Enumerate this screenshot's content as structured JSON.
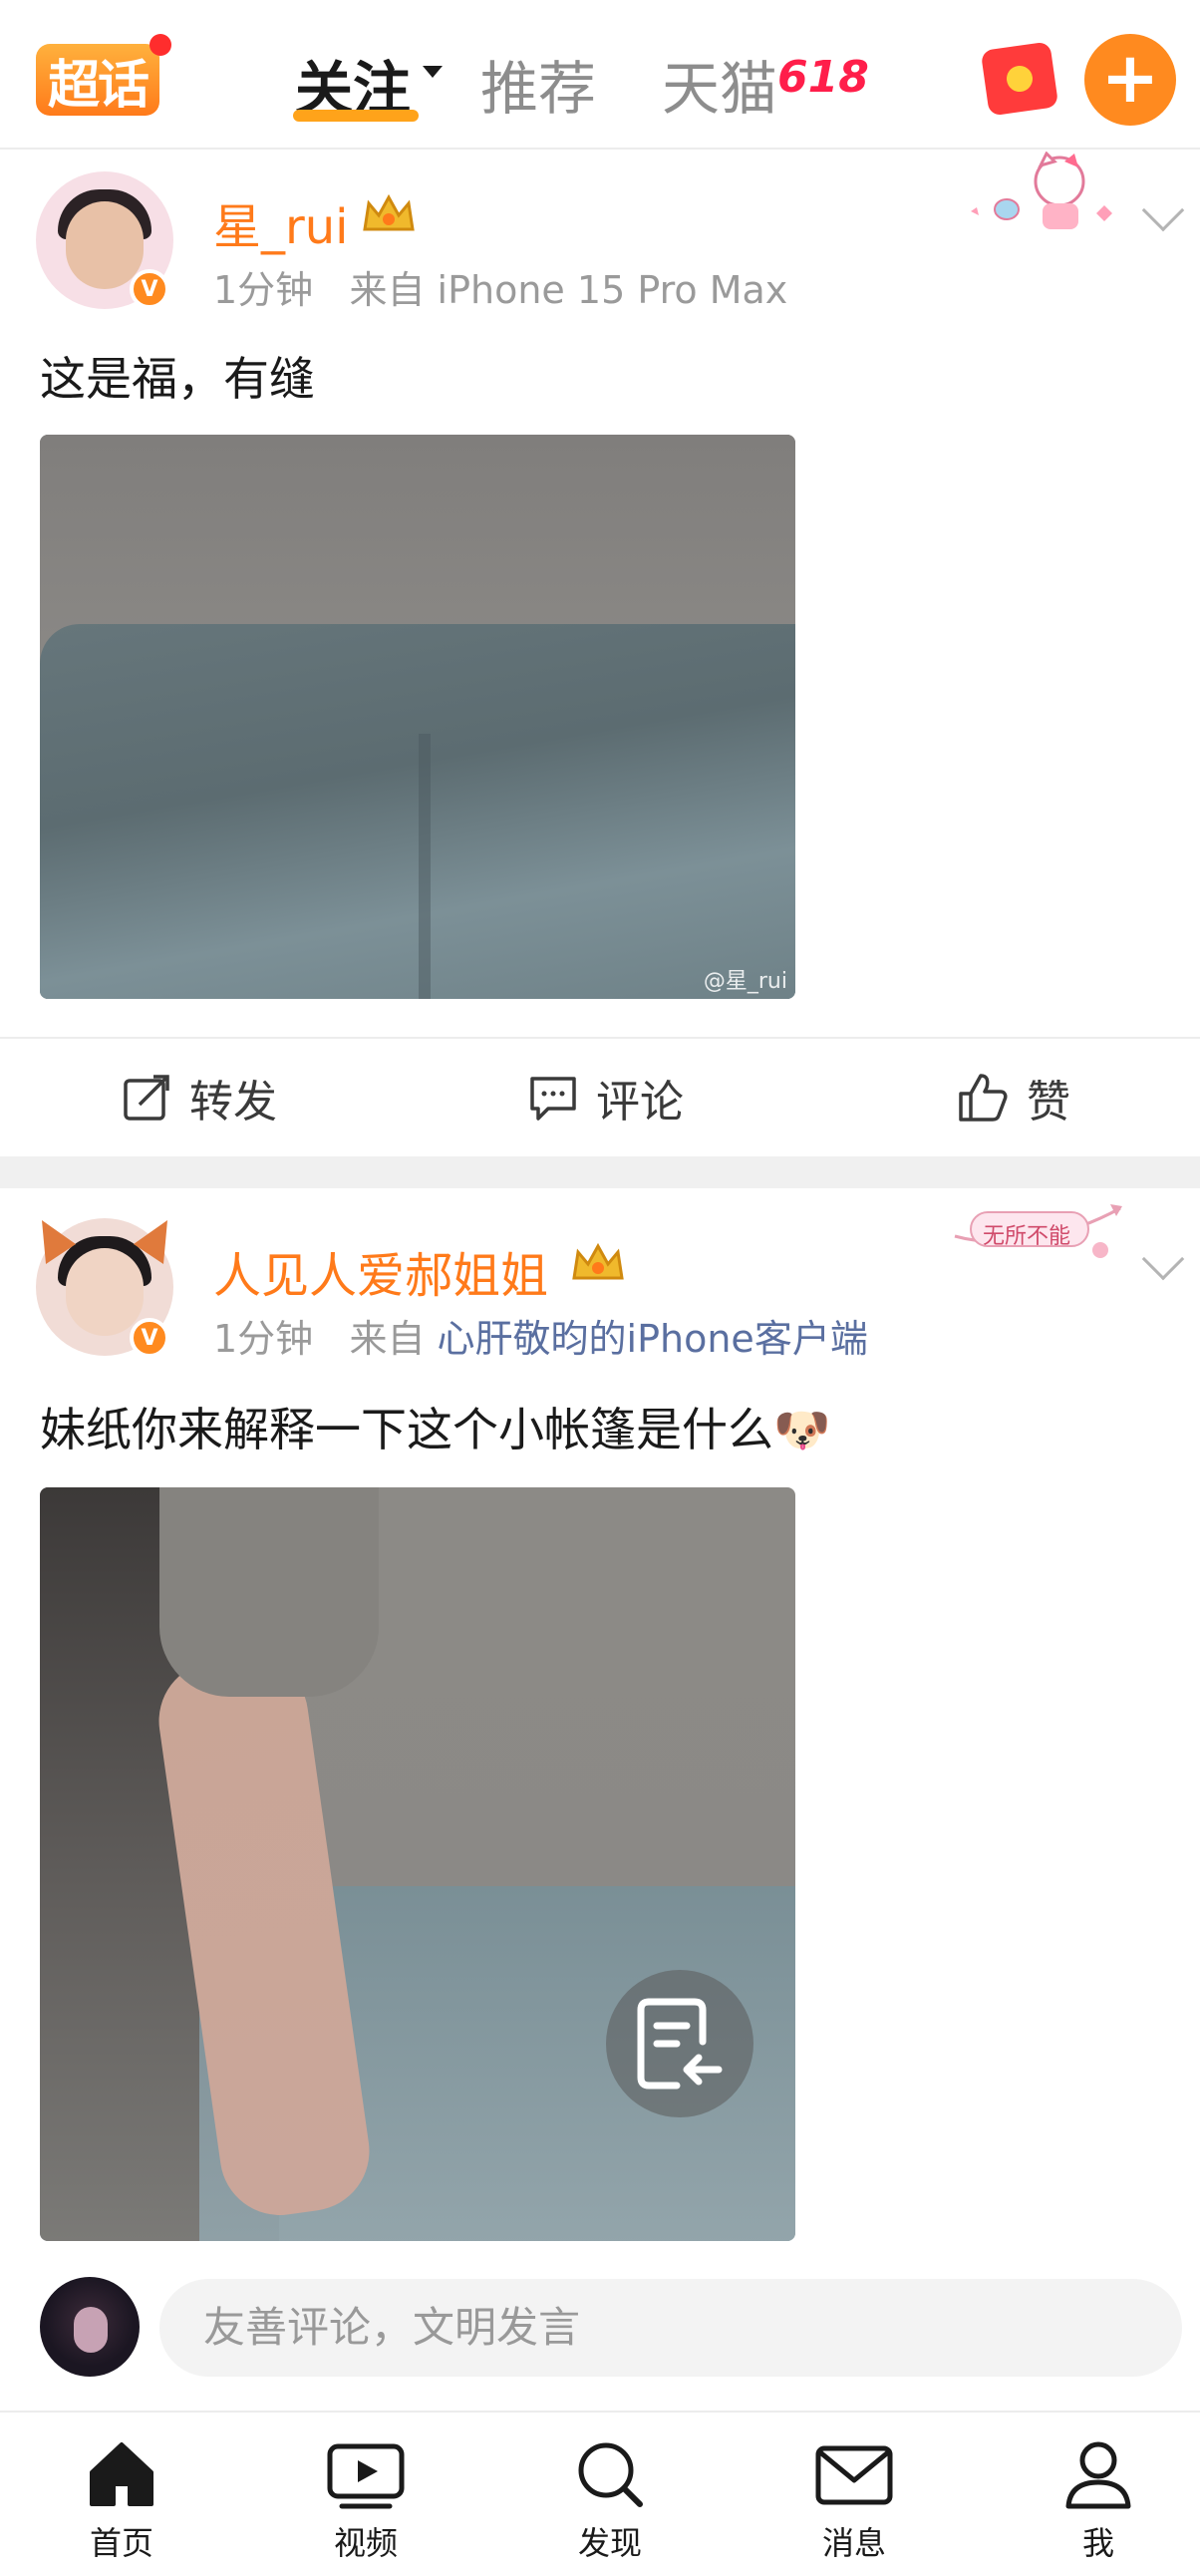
{
  "header": {
    "logo_text": "超话",
    "tabs": [
      {
        "label": "关注",
        "active": true
      },
      {
        "label": "推荐",
        "active": false
      },
      {
        "label": "天猫",
        "active": false
      }
    ],
    "tmall_badge": "618",
    "accent_color": "#ff8a1f"
  },
  "posts": [
    {
      "username": "星_rui",
      "time": "1分钟",
      "source_prefix": "来自",
      "source": "iPhone 15 Pro Max",
      "text": "这是福，有缝",
      "watermark": "@星_rui",
      "actions": {
        "repost": "转发",
        "comment": "评论",
        "like": "赞"
      }
    },
    {
      "username": "人见人爱郝姐姐",
      "time": "1分钟",
      "source_prefix": "来自",
      "source": "心肝敬昀的iPhone客户端",
      "text": "妹纸你来解释一下这个小帐篷是什么🐶",
      "sticker_text": "无所不能"
    }
  ],
  "comment_input": {
    "placeholder": "友善评论，文明发言"
  },
  "bottom_nav": [
    {
      "label": "首页",
      "icon": "home-icon"
    },
    {
      "label": "视频",
      "icon": "video-icon"
    },
    {
      "label": "发现",
      "icon": "search-icon"
    },
    {
      "label": "消息",
      "icon": "mail-icon"
    },
    {
      "label": "我",
      "icon": "profile-icon"
    }
  ]
}
